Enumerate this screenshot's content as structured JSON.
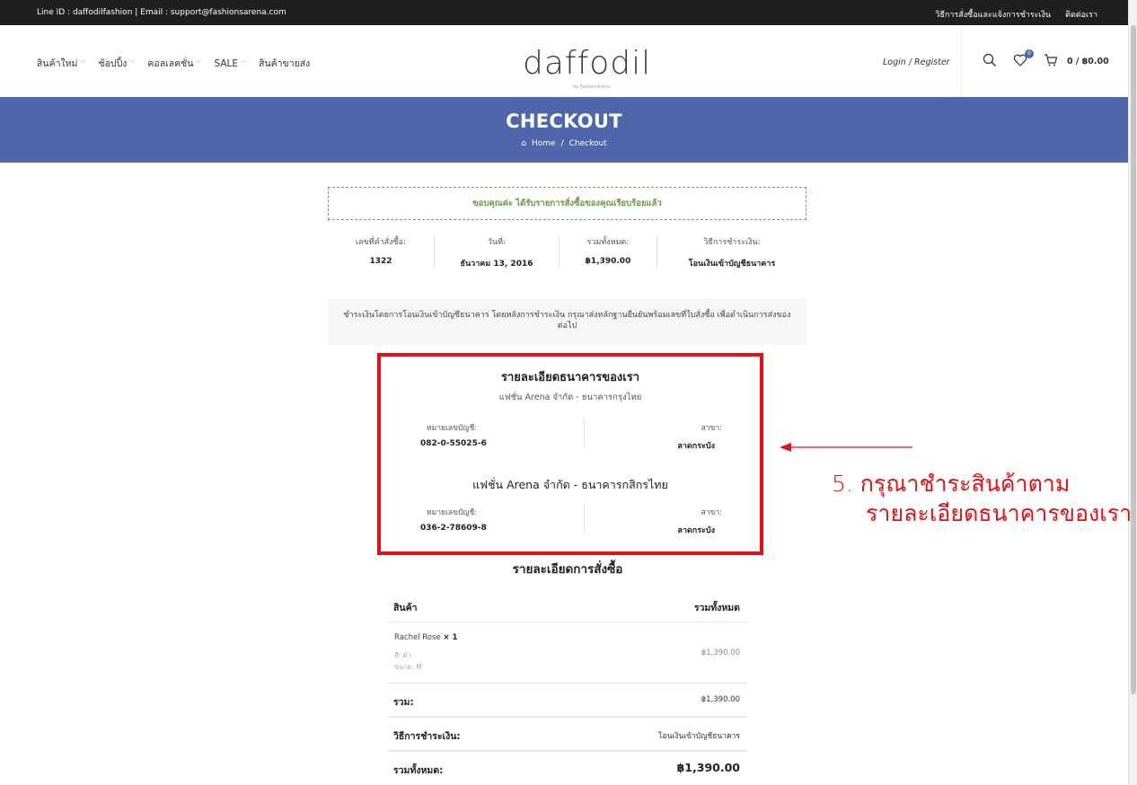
{
  "topbar": {
    "contact": "Line ID : daffodilfashion | Email : support@fashionsarena.com",
    "links": [
      "วิธีการสั่งซื้อและแจ้งการชำระเงิน",
      "ติดต่อเรา"
    ]
  },
  "nav": {
    "items": [
      "สินค้าใหม่",
      "ช้อปปิ้ง",
      "คอลเลคชั่น",
      "SALE",
      "สินค้าขายส่ง"
    ]
  },
  "logo": {
    "text": "daffodil",
    "tagline": "by FashionArena"
  },
  "account": {
    "login": "Login / Register"
  },
  "wishlist": {
    "count": "0"
  },
  "cart": {
    "label": "0 / ฿0.00"
  },
  "banner": {
    "title": "CHECKOUT",
    "breadcrumb": {
      "home": "Home",
      "separator": "/",
      "current": "Checkout"
    }
  },
  "notice": "ขอบคุณค่ะ ได้รับรายการสั่งซื้อของคุณเรียบร้อยแล้ว",
  "overview": [
    {
      "label": "เลขที่คำสั่งซื้อ:",
      "value": "1322"
    },
    {
      "label": "วันที่:",
      "value": "ธันวาคม 13, 2016"
    },
    {
      "label": "รวมทั้งหมด:",
      "value": "฿1,390.00"
    },
    {
      "label": "วิธีการชำระเงิน:",
      "value": "โอนเงินเข้าบัญชีธนาคาร"
    }
  ],
  "instructions": "ชำระเงินโดยการโอนเงินเข้าบัญชีธนาคาร โดยหลังการชำระเงิน กรุณาส่งหลักฐานยืนยันพร้อมเลขที่ใบสั่งซื้อ เพื่อดำเนินการส่งของต่อไป",
  "bank": {
    "title": "รายละเอียดธนาคารของเรา",
    "accounts": [
      {
        "bank_name": "แฟชั่น Arena จำกัด - ธนาคารกรุงไทย",
        "account_label": "หมายเลขบัญชี:",
        "account_number": "082-0-55025-6",
        "branch_label": "สาขา:",
        "branch": "ลาดกระบัง"
      },
      {
        "bank_name": "แฟชั่น Arena จำกัด - ธนาคารกสิกรไทย",
        "account_label": "หมายเลขบัญชี:",
        "account_number": "036-2-78609-8",
        "branch_label": "สาขา:",
        "branch": "ลาดกระบัง"
      }
    ]
  },
  "callout": {
    "line1": "5. กรุณาชำระสินค้าตาม",
    "line2": "รายละเอียดธนาคารของเรา",
    "color": "#e21017"
  },
  "order_details": {
    "title": "รายละเอียดการสั่งซื้อ",
    "headers": {
      "product": "สินค้า",
      "total": "รวมทั้งหมด"
    },
    "items": [
      {
        "name": "Rachel Rose",
        "qty": "× 1",
        "color": "สี: ดำ",
        "size": "ขนาด: M",
        "price": "฿1,390.00"
      }
    ],
    "subtotal": {
      "label": "รวม:",
      "value": "฿1,390.00"
    },
    "payment": {
      "label": "วิธีการชำระเงิน:",
      "value": "โอนเงินเข้าบัญชีธนาคาร"
    },
    "total": {
      "label": "รวมทั้งหมด:",
      "value": "฿1,390.00"
    }
  },
  "colors": {
    "brand": "#4f66ad",
    "highlight": "#e21017",
    "success": "#6f944e"
  }
}
